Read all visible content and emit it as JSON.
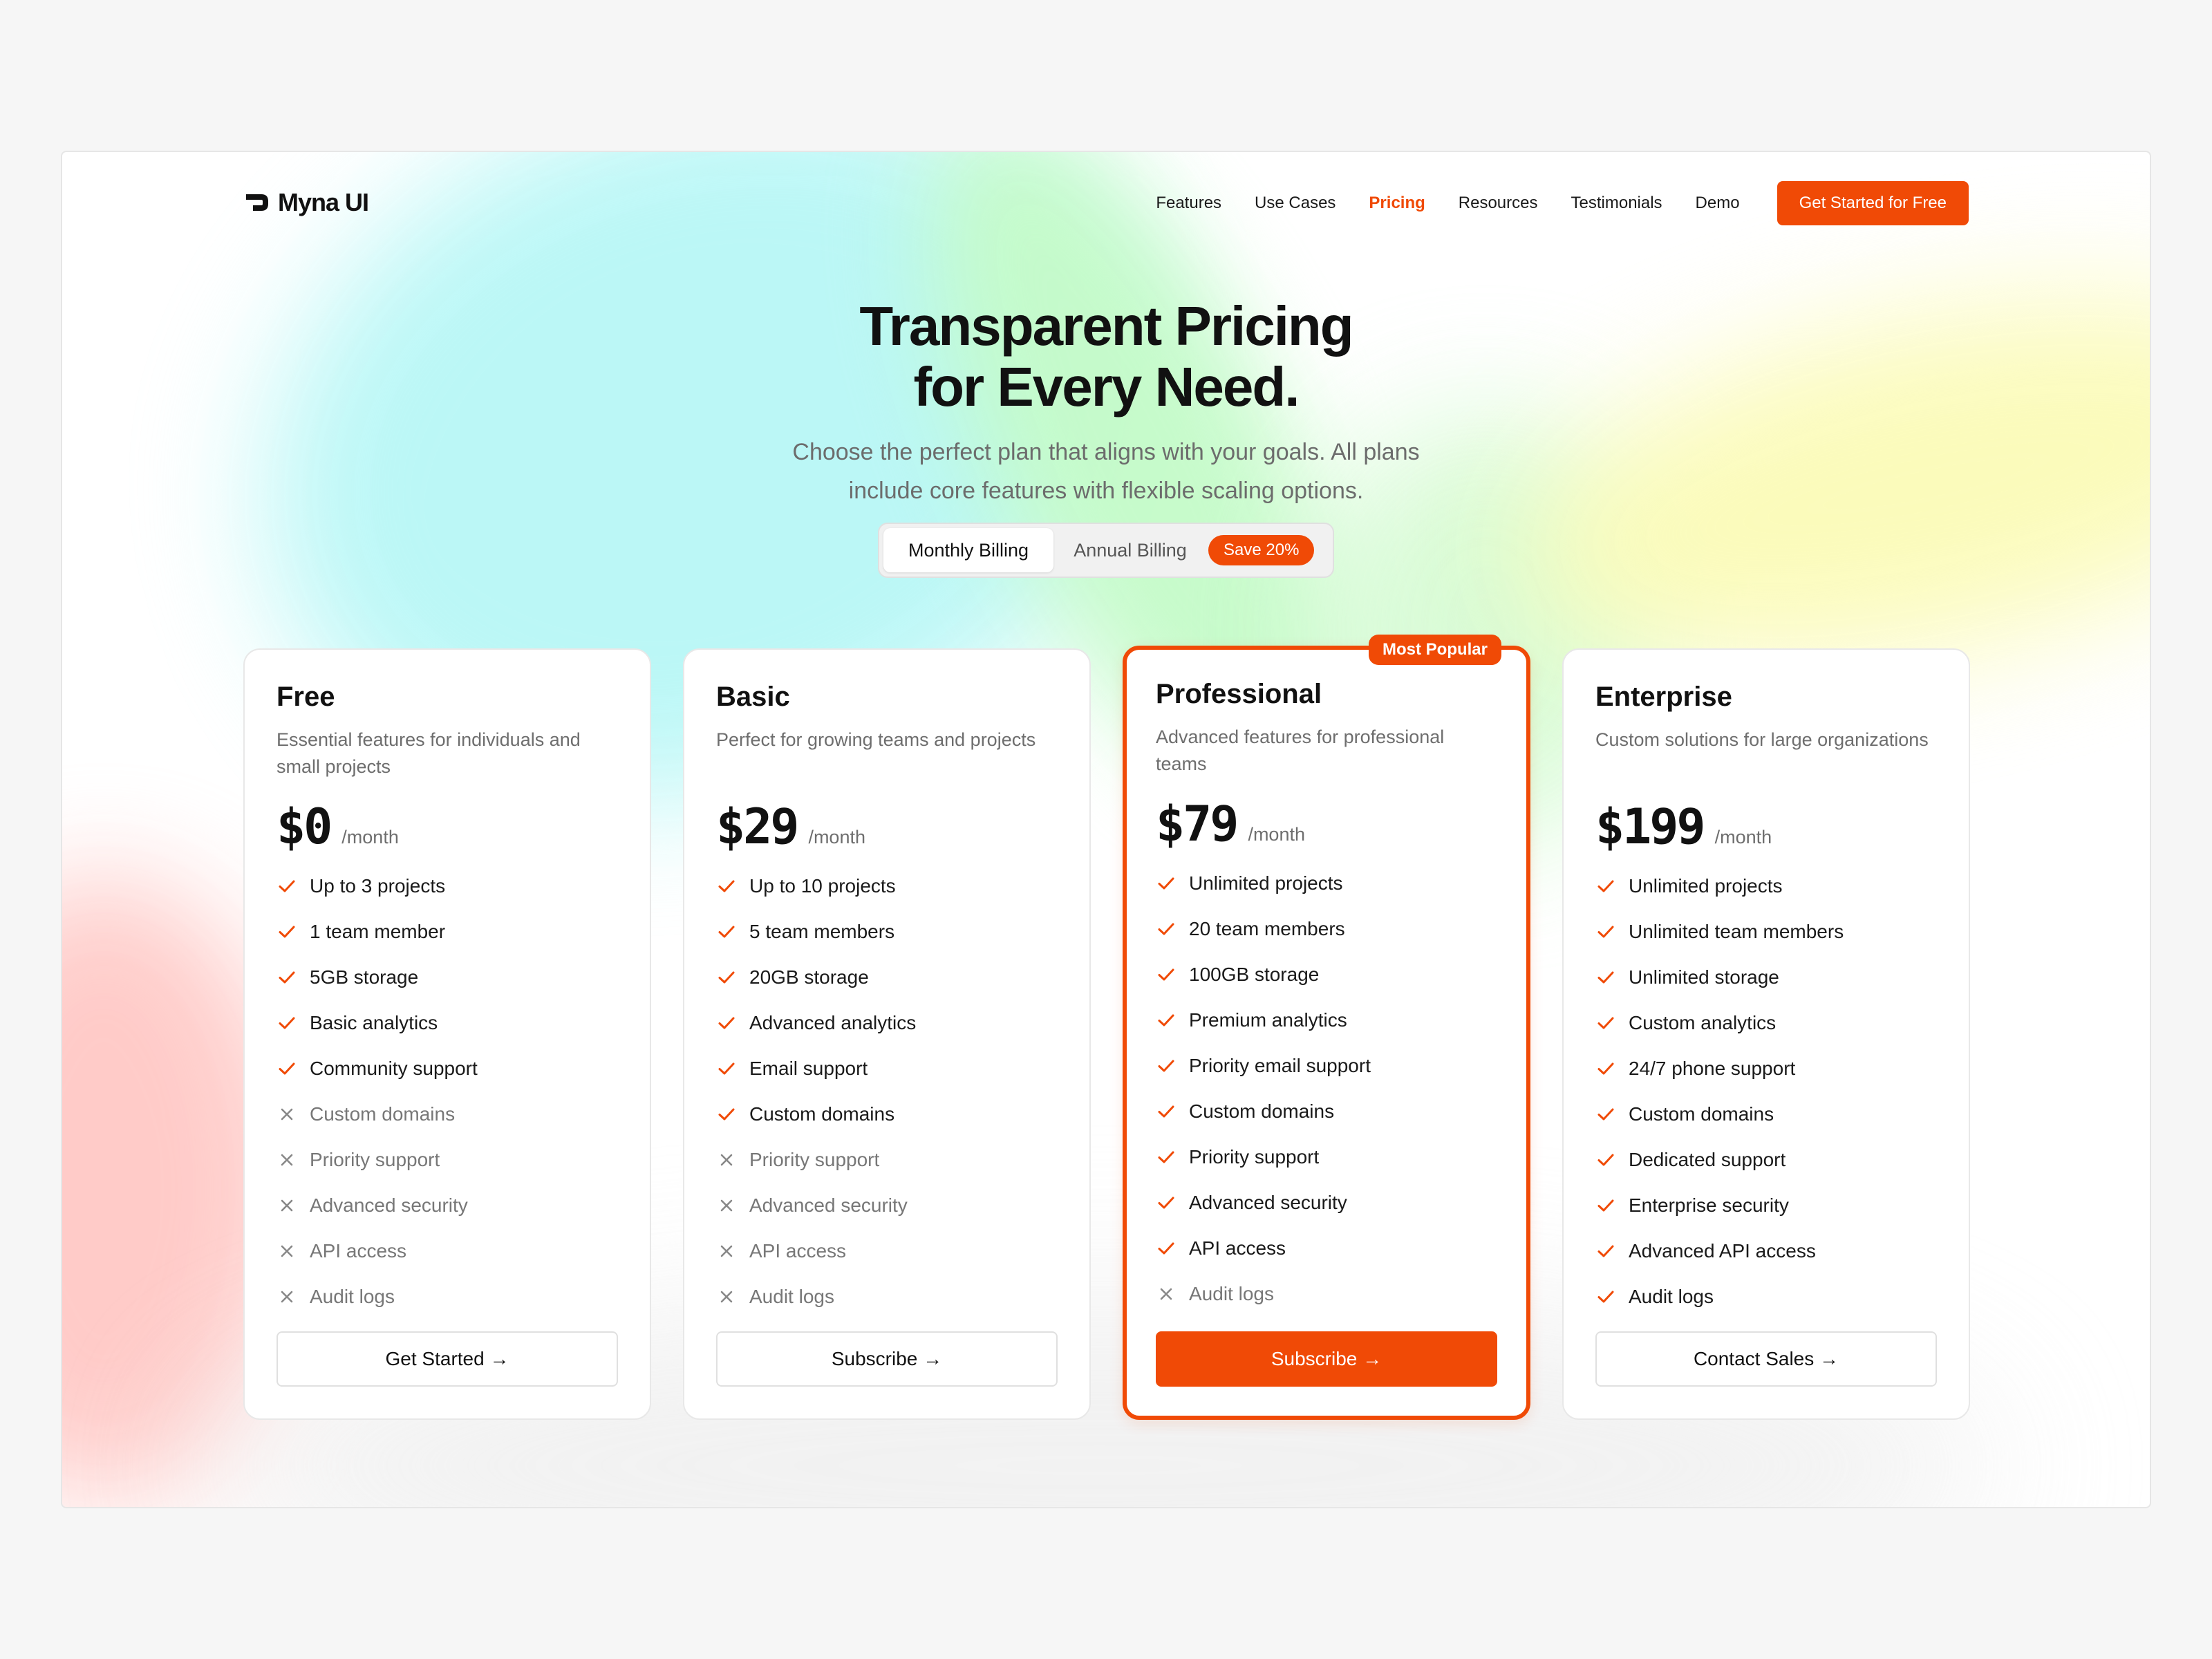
{
  "brand": {
    "name": "Myna UI"
  },
  "nav": {
    "links": [
      "Features",
      "Use Cases",
      "Pricing",
      "Resources",
      "Testimonials",
      "Demo"
    ],
    "active": "Pricing",
    "cta": "Get Started for Free"
  },
  "hero": {
    "title_line1": "Transparent Pricing",
    "title_line2": "for Every Need.",
    "subtitle": "Choose the perfect plan that aligns with your goals. All plans include core features with flexible scaling options."
  },
  "billing": {
    "monthly": "Monthly Billing",
    "annual": "Annual Billing",
    "save_badge": "Save 20%"
  },
  "colors": {
    "accent": "#f04a06",
    "text": "#111111",
    "muted": "#6e6e6e"
  },
  "plans": [
    {
      "name": "Free",
      "description": "Essential features for individuals and small projects",
      "price": "$0",
      "period": "/month",
      "features": [
        {
          "text": "Up to 3 projects",
          "included": true
        },
        {
          "text": "1 team member",
          "included": true
        },
        {
          "text": "5GB storage",
          "included": true
        },
        {
          "text": "Basic analytics",
          "included": true
        },
        {
          "text": "Community support",
          "included": true
        },
        {
          "text": "Custom domains",
          "included": false
        },
        {
          "text": "Priority support",
          "included": false
        },
        {
          "text": "Advanced security",
          "included": false
        },
        {
          "text": "API access",
          "included": false
        },
        {
          "text": "Audit logs",
          "included": false
        }
      ],
      "button": "Get Started →"
    },
    {
      "name": "Basic",
      "description": "Perfect for growing teams and projects",
      "price": "$29",
      "period": "/month",
      "features": [
        {
          "text": "Up to 10 projects",
          "included": true
        },
        {
          "text": "5 team members",
          "included": true
        },
        {
          "text": "20GB storage",
          "included": true
        },
        {
          "text": "Advanced analytics",
          "included": true
        },
        {
          "text": "Email support",
          "included": true
        },
        {
          "text": "Custom domains",
          "included": true
        },
        {
          "text": "Priority support",
          "included": false
        },
        {
          "text": "Advanced security",
          "included": false
        },
        {
          "text": "API access",
          "included": false
        },
        {
          "text": "Audit logs",
          "included": false
        }
      ],
      "button": "Subscribe →"
    },
    {
      "name": "Professional",
      "description": "Advanced features for professional teams",
      "price": "$79",
      "period": "/month",
      "badge": "Most Popular",
      "features": [
        {
          "text": "Unlimited projects",
          "included": true
        },
        {
          "text": "20 team members",
          "included": true
        },
        {
          "text": "100GB storage",
          "included": true
        },
        {
          "text": "Premium analytics",
          "included": true
        },
        {
          "text": "Priority email support",
          "included": true
        },
        {
          "text": "Custom domains",
          "included": true
        },
        {
          "text": "Priority support",
          "included": true
        },
        {
          "text": "Advanced security",
          "included": true
        },
        {
          "text": "API access",
          "included": true
        },
        {
          "text": "Audit logs",
          "included": false
        }
      ],
      "button": "Subscribe →"
    },
    {
      "name": "Enterprise",
      "description": "Custom solutions for large organizations",
      "price": "$199",
      "period": "/month",
      "features": [
        {
          "text": "Unlimited projects",
          "included": true
        },
        {
          "text": "Unlimited team members",
          "included": true
        },
        {
          "text": "Unlimited storage",
          "included": true
        },
        {
          "text": "Custom analytics",
          "included": true
        },
        {
          "text": "24/7 phone support",
          "included": true
        },
        {
          "text": "Custom domains",
          "included": true
        },
        {
          "text": "Dedicated support",
          "included": true
        },
        {
          "text": "Enterprise security",
          "included": true
        },
        {
          "text": "Advanced API access",
          "included": true
        },
        {
          "text": "Audit logs",
          "included": true
        }
      ],
      "button": "Contact Sales →"
    }
  ]
}
